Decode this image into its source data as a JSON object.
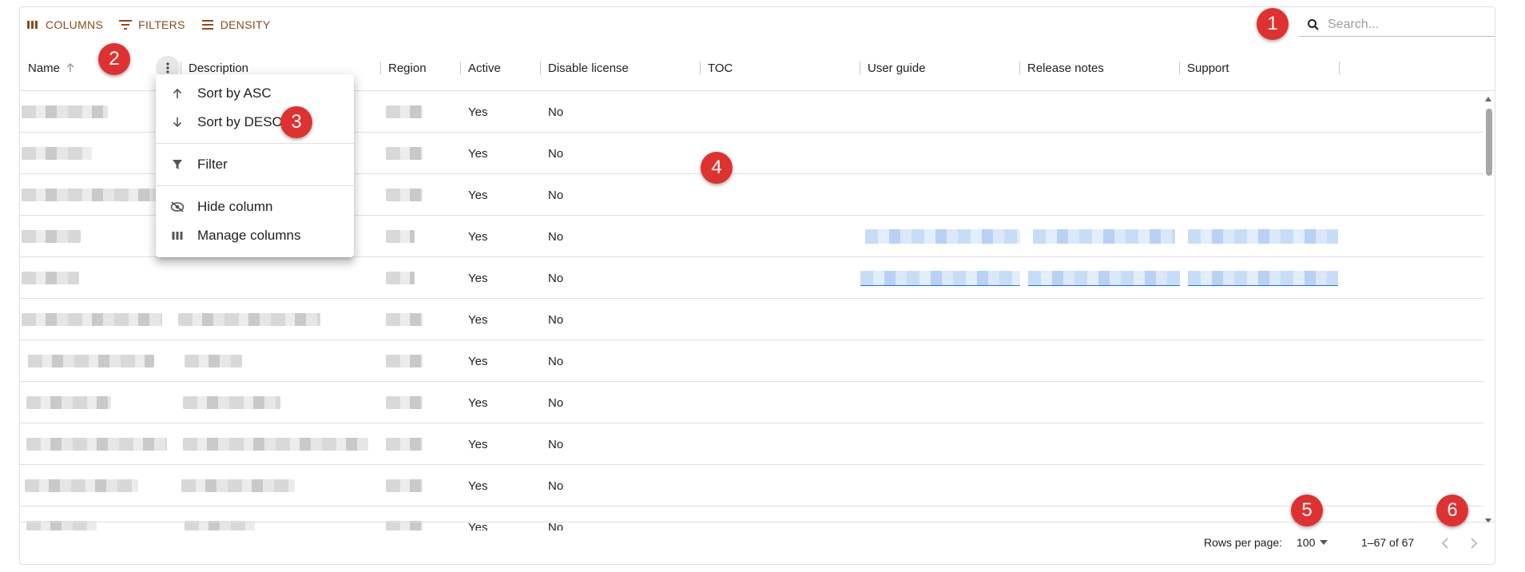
{
  "toolbar": {
    "columns_label": "COLUMNS",
    "filters_label": "FILTERS",
    "density_label": "DENSITY"
  },
  "search": {
    "placeholder": "Search..."
  },
  "columns": [
    "Name",
    "Description",
    "Region",
    "Active",
    "Disable license",
    "TOC",
    "User guide",
    "Release notes",
    "Support"
  ],
  "rows": [
    {
      "active": "Yes",
      "disable": "No"
    },
    {
      "active": "Yes",
      "disable": "No"
    },
    {
      "active": "Yes",
      "disable": "No"
    },
    {
      "active": "Yes",
      "disable": "No"
    },
    {
      "active": "Yes",
      "disable": "No"
    },
    {
      "active": "Yes",
      "disable": "No"
    },
    {
      "active": "Yes",
      "disable": "No"
    },
    {
      "active": "Yes",
      "disable": "No"
    },
    {
      "active": "Yes",
      "disable": "No"
    },
    {
      "active": "Yes",
      "disable": "No"
    },
    {
      "active": "Yes",
      "disable": "No"
    }
  ],
  "column_menu": {
    "sort_asc": "Sort by ASC",
    "sort_desc": "Sort by DESC",
    "filter": "Filter",
    "hide_column": "Hide column",
    "manage_columns": "Manage columns"
  },
  "footer": {
    "rows_per_page_label": "Rows per page:",
    "rows_per_page_value": "100",
    "range": "1–67 of 67"
  },
  "annotations": [
    "1",
    "2",
    "3",
    "4",
    "5",
    "6"
  ],
  "colors": {
    "accent": "#8a4b1c",
    "badge": "#e03131",
    "link": "#1a73e8"
  }
}
